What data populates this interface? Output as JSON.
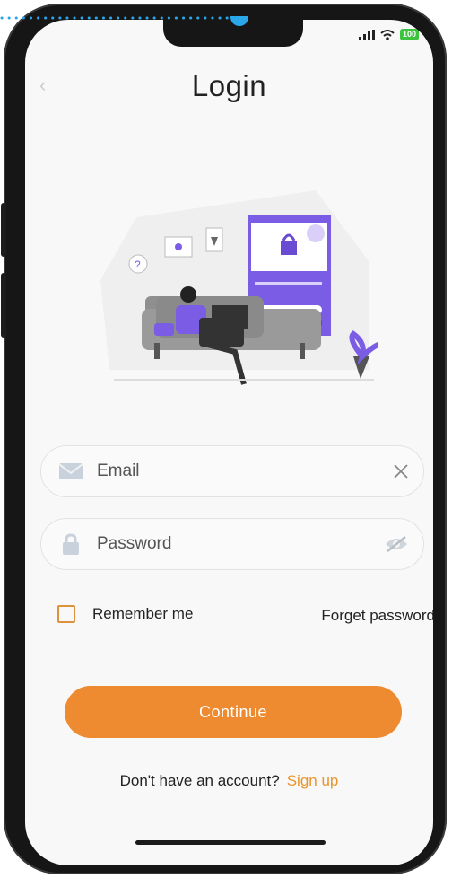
{
  "status_bar": {
    "battery": "100"
  },
  "header": {
    "title": "Login"
  },
  "form": {
    "email": {
      "placeholder": "Email",
      "value": ""
    },
    "password": {
      "placeholder": "Password",
      "value": ""
    },
    "remember_label": "Remember me",
    "remember_checked": false,
    "forget_label": "Forget password"
  },
  "actions": {
    "continue_label": "Continue"
  },
  "footer": {
    "prompt": "Don't have an account?",
    "signup_label": "Sign up"
  },
  "colors": {
    "accent": "#ee8a30",
    "illustration": "#7b5ce5",
    "annotation": "#29a7e8"
  },
  "icons": [
    "signal-icon",
    "wifi-icon",
    "battery-icon",
    "back-chevron-icon",
    "mail-icon",
    "clear-x-icon",
    "lock-icon",
    "eye-off-icon"
  ]
}
